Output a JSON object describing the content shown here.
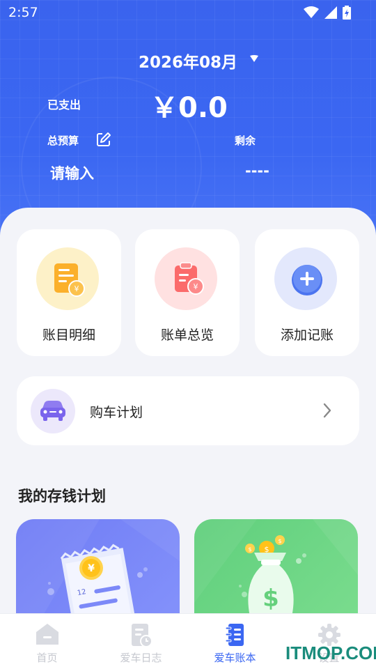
{
  "status": {
    "time": "2:57"
  },
  "header": {
    "month": "2026年08月",
    "spent_label": "已支出",
    "spent_amount": "￥0.0",
    "budget_label": "总预算",
    "remain_label": "剩余",
    "budget_value": "请输入",
    "remain_value": "----"
  },
  "quick_actions": [
    {
      "label": "账目明细",
      "icon": "ledger-detail-icon"
    },
    {
      "label": "账单总览",
      "icon": "bill-overview-icon"
    },
    {
      "label": "添加记账",
      "icon": "add-record-icon"
    }
  ],
  "car_plan": {
    "label": "购车计划",
    "icon": "car-icon"
  },
  "savings": {
    "title": "我的存钱计划",
    "receipt_number": "12"
  },
  "tabs": [
    {
      "label": "首页",
      "icon": "home-icon",
      "active": false
    },
    {
      "label": "爱车日志",
      "icon": "car-log-icon",
      "active": false
    },
    {
      "label": "爱车账本",
      "icon": "car-ledger-icon",
      "active": true
    },
    {
      "label": "设置",
      "icon": "settings-icon",
      "active": false
    }
  ],
  "watermark": "ITMOP.COM",
  "colors": {
    "primary": "#3b67f2",
    "purple_card": "#7683f7",
    "green_card": "#6bd585"
  }
}
